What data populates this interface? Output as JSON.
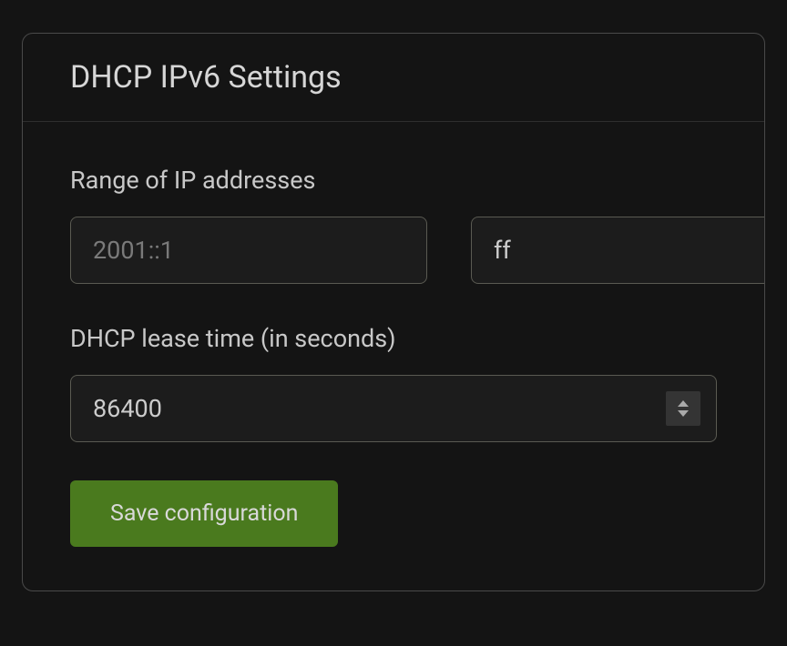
{
  "card": {
    "title": "DHCP IPv6 Settings"
  },
  "range": {
    "label": "Range of IP addresses",
    "start_placeholder": "2001::1",
    "start_value": "",
    "end_value": "ff"
  },
  "lease": {
    "label": "DHCP lease time (in seconds)",
    "value": "86400"
  },
  "actions": {
    "save_label": "Save configuration"
  }
}
